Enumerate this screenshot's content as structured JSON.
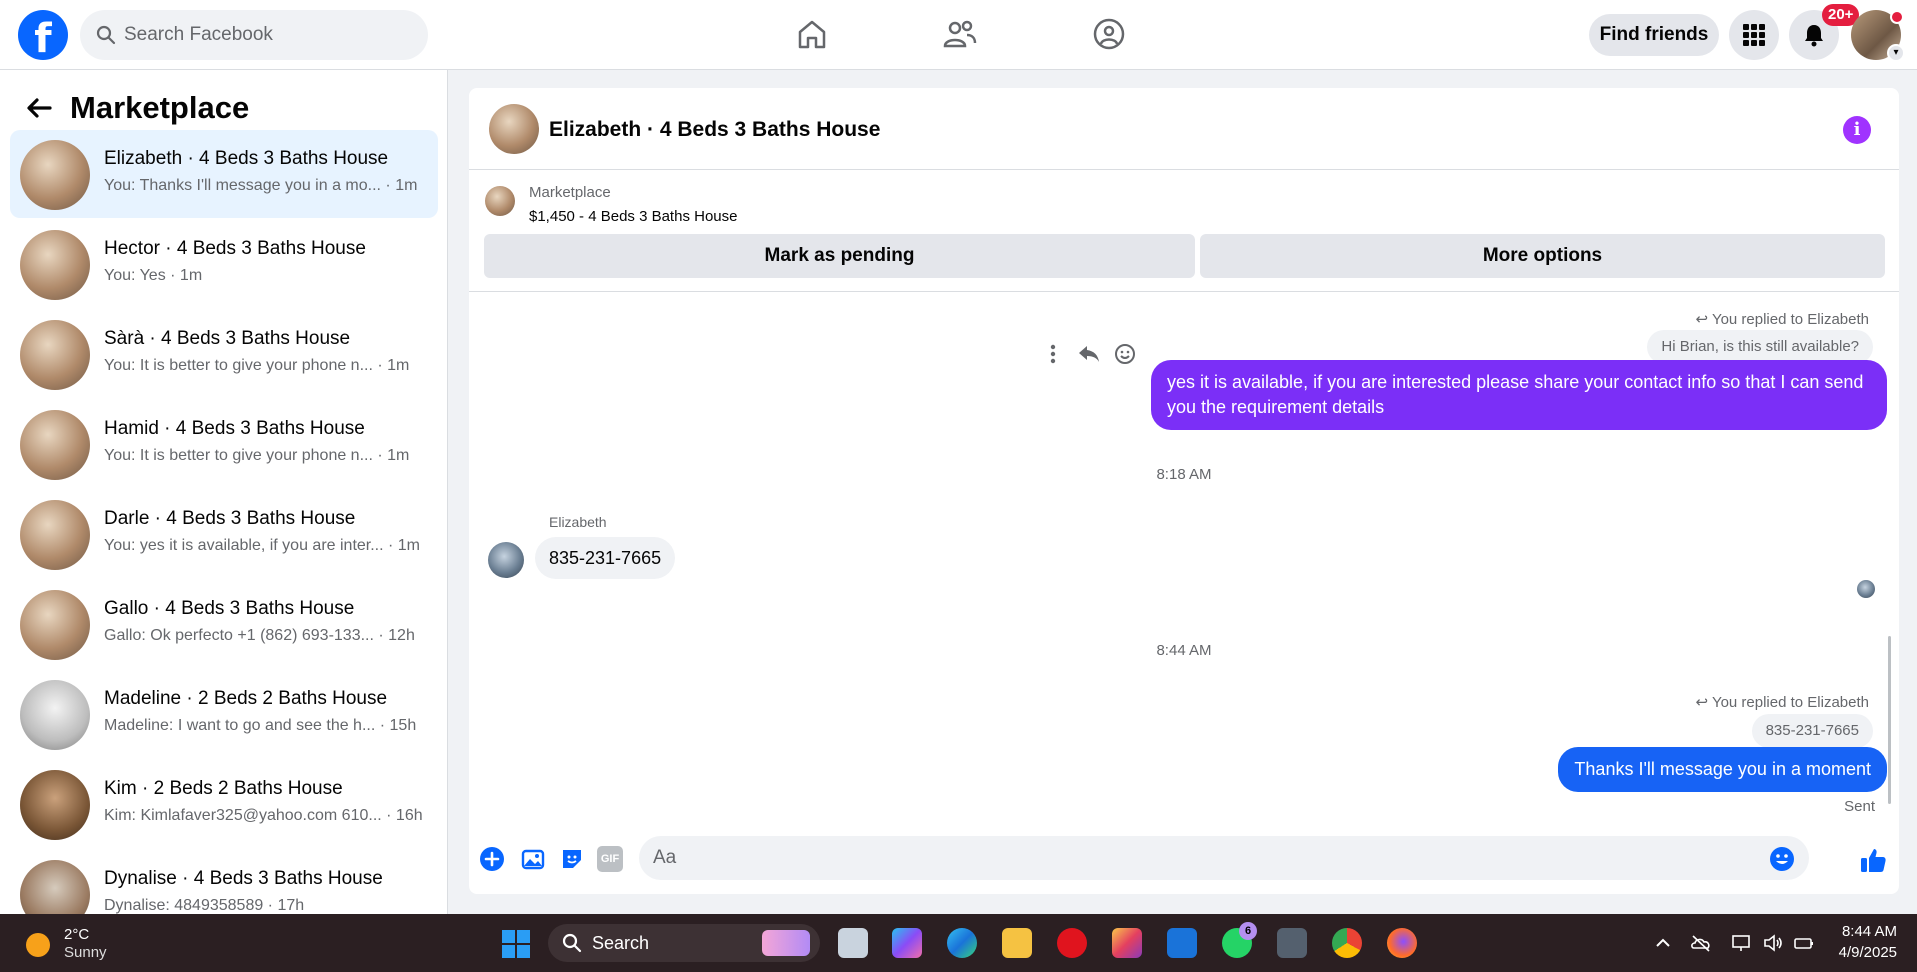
{
  "topbar": {
    "logo": "f",
    "search_placeholder": "Search Facebook",
    "nav_icons": [
      "home-icon",
      "friends-icon",
      "groups-icon"
    ],
    "find_friends_label": "Find friends",
    "notification_badge": "20+"
  },
  "left": {
    "title": "Marketplace",
    "conversations": [
      {
        "name": "Elizabeth · 4 Beds 3 Baths House",
        "preview": "You: Thanks I'll message you in a mo...",
        "time": "1m",
        "active": true
      },
      {
        "name": "Hector · 4 Beds 3 Baths House",
        "preview": "You: Yes",
        "time": "1m"
      },
      {
        "name": "Sàrà · 4 Beds 3 Baths House",
        "preview": "You: It is better to give your phone n...",
        "time": "1m"
      },
      {
        "name": "Hamid · 4 Beds 3 Baths House",
        "preview": "You: It is better to give your phone n...",
        "time": "1m"
      },
      {
        "name": "Darle · 4 Beds 3 Baths House",
        "preview": "You: yes it is available, if you are inter...",
        "time": "1m"
      },
      {
        "name": "Gallo · 4 Beds 3 Baths House",
        "preview": "Gallo: Ok perfecto +1 (862) 693-133...",
        "time": "12h"
      },
      {
        "name": "Madeline · 2 Beds 2 Baths House",
        "preview": "Madeline: I want to go and see the h...",
        "time": "15h"
      },
      {
        "name": "Kim · 2 Beds 2 Baths House",
        "preview": "Kim: Kimlafaver325@yahoo.com 610...",
        "time": "16h"
      },
      {
        "name": "Dynalise · 4 Beds 3 Baths House",
        "preview": "Dynalise: 4849358589",
        "time": "17h"
      }
    ]
  },
  "chat": {
    "title": "Elizabeth · 4 Beds 3 Baths House",
    "info_icon": "i",
    "listing_source": "Marketplace",
    "listing_price_title": "$1,450 - 4 Beds 3 Baths House",
    "mark_pending_label": "Mark as pending",
    "more_options_label": "More options",
    "reply_meta_1": "You replied to Elizabeth",
    "quoted_1": "Hi Brian, is this still available?",
    "outgoing_1": "yes it is available, if you are interested please share your contact info so that I can send you the requirement details",
    "outgoing_1_color": "#7b2ff7",
    "time_1": "8:18 AM",
    "sender_name": "Elizabeth",
    "incoming_1": "835-231-7665",
    "time_2": "8:44 AM",
    "reply_meta_2": "You replied to Elizabeth",
    "quoted_2": "835-231-7665",
    "outgoing_2": "Thanks I'll message you in a moment",
    "outgoing_2_color": "#1763f5",
    "sent_label": "Sent",
    "composer_placeholder": "Aa",
    "gif_label": "GIF"
  },
  "taskbar": {
    "temperature": "2°C",
    "condition": "Sunny",
    "search_label": "Search",
    "whatsapp_badge": "6",
    "time": "8:44 AM",
    "date": "4/9/2025"
  }
}
